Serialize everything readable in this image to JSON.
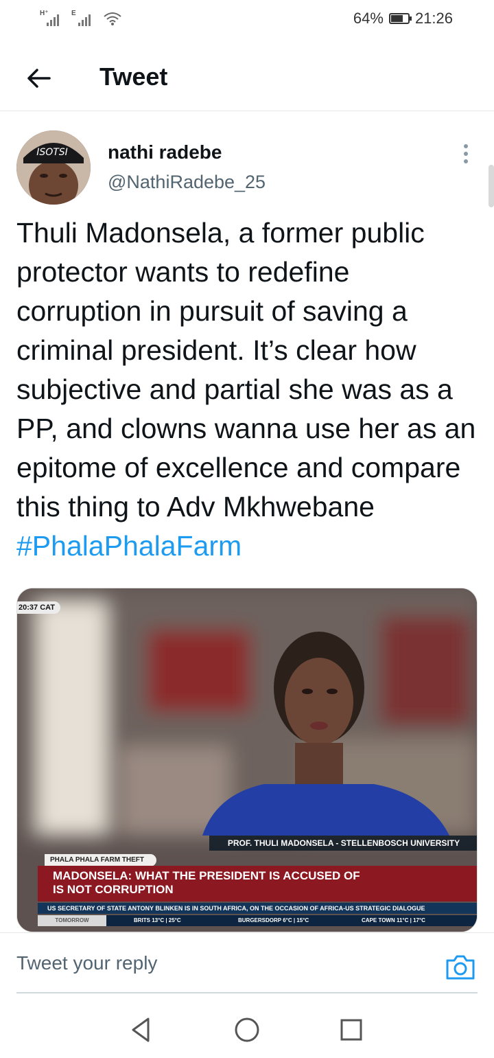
{
  "status_bar": {
    "network_1": "H⁺",
    "network_2": "E",
    "battery": "64%",
    "battery_level": 0.64,
    "time": "21:26"
  },
  "header": {
    "title": "Tweet",
    "back_icon": "arrow-left-icon"
  },
  "tweet": {
    "author_name": "nathi radebe",
    "author_handle": "@NathiRadebe_25",
    "avatar_text": "ISOTSI",
    "text": "Thuli Madonsela, a former public protector wants to redefine corruption in pursuit of saving a criminal president. It’s clear how subjective and partial she was as a PP, and clowns wanna use her as an epitome of excellence and compare this thing to Adv Mkhwebane ",
    "hashtag": "#PhalaPhalaFarm",
    "hashtag_color": "#1d9bf0"
  },
  "media": {
    "timestamp": "20:37 CAT",
    "caption": "PROF. THULI MADONSELA - STELLENBOSCH UNIVERSITY",
    "story_tag": "PHALA PHALA FARM THEFT",
    "headline_line1": "MADONSELA: WHAT THE PRESIDENT IS ACCUSED OF",
    "headline_line2": "IS NOT CORRUPTION",
    "ticker": "US SECRETARY OF STATE ANTONY BLINKEN IS IN SOUTH AFRICA, ON THE OCCASION OF AFRICA-US STRATEGIC DIALOGUE",
    "weather_tomorrow": "TOMORROW",
    "weather_1": "BRITS 13°C | 25°C",
    "weather_2": "BURGERSDORP 6°C | 15°C",
    "weather_3": "CAPE TOWN 11°C | 17°C",
    "headline_color": "#8c1822"
  },
  "reply": {
    "placeholder": "Tweet your reply",
    "camera_icon": "camera-icon",
    "accent": "#1d9bf0"
  },
  "nav": {
    "back": "nav-back-icon",
    "home": "nav-home-icon",
    "recents": "nav-recents-icon"
  }
}
